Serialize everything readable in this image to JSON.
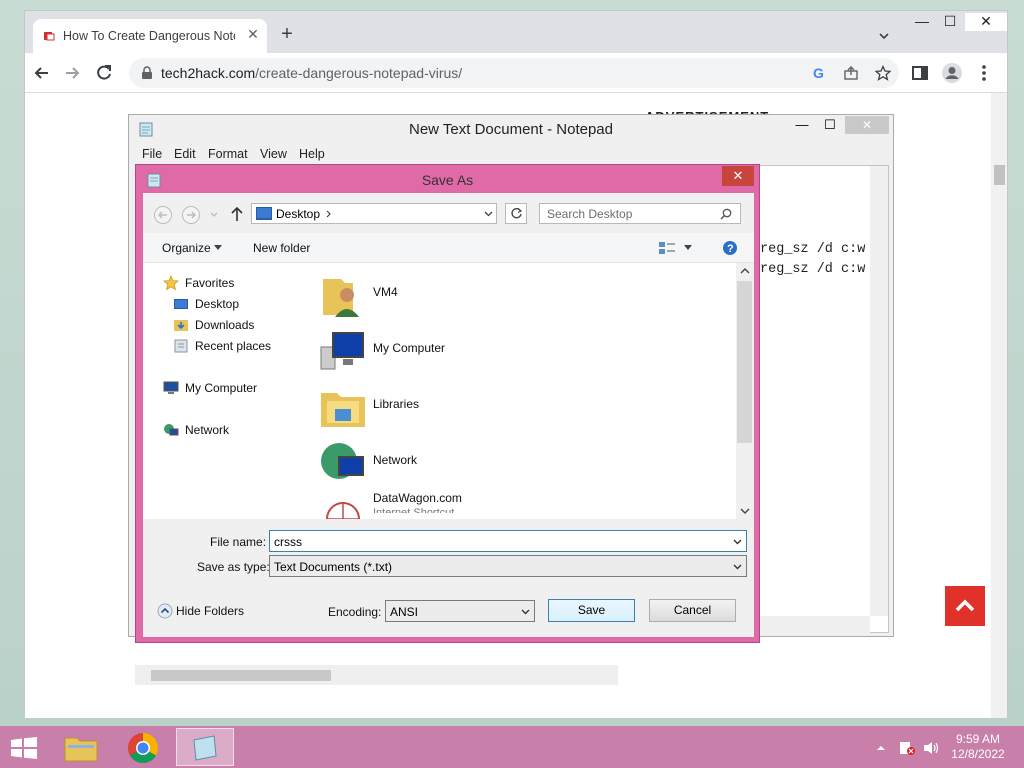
{
  "browser": {
    "tab_title": "How To Create Dangerous Notepad Virus",
    "new_tab": "+",
    "url_domain": "tech2hack.com",
    "url_path": "/create-dangerous-notepad-virus/",
    "page_text_fragment": "ADVERTISEMENT",
    "window_controls": {
      "minimize": "—",
      "maximize": "☐",
      "close": "✕"
    }
  },
  "notepad": {
    "title": "New Text Document - Notepad",
    "menu": [
      "File",
      "Edit",
      "Format",
      "View",
      "Help"
    ],
    "lines": [
      "reg_sz /d c:w",
      "reg_sz /d c:w"
    ]
  },
  "save_as": {
    "title": "Save As",
    "close": "✕",
    "location": "Desktop",
    "search_placeholder": "Search Desktop",
    "organize": "Organize",
    "new_folder": "New folder",
    "nav": {
      "favorites": "Favorites",
      "desktop": "Desktop",
      "downloads": "Downloads",
      "recent": "Recent places",
      "my_computer": "My Computer",
      "network": "Network"
    },
    "files": [
      {
        "name": "VM4",
        "icon": "user-folder-icon"
      },
      {
        "name": "My Computer",
        "icon": "computer-icon"
      },
      {
        "name": "Libraries",
        "icon": "libraries-folder-icon"
      },
      {
        "name": "Network",
        "icon": "network-globe-icon"
      },
      {
        "name": "DataWagon.com",
        "sub": "Internet Shortcut",
        "icon": "internet-shortcut-icon"
      }
    ],
    "file_name_label": "File name:",
    "file_name_value": "crsss",
    "save_type_label": "Save as type:",
    "save_type_value": "Text Documents (*.txt)",
    "hide_folders": "Hide Folders",
    "encoding_label": "Encoding:",
    "encoding_value": "ANSI",
    "save": "Save",
    "cancel": "Cancel"
  },
  "taskbar": {
    "time": "9:59 AM",
    "date": "12/8/2022"
  },
  "colors": {
    "dialog_frame": "#e06aa8",
    "taskbar": "#c87fa9",
    "scroll_top_button": "#e0322b"
  }
}
